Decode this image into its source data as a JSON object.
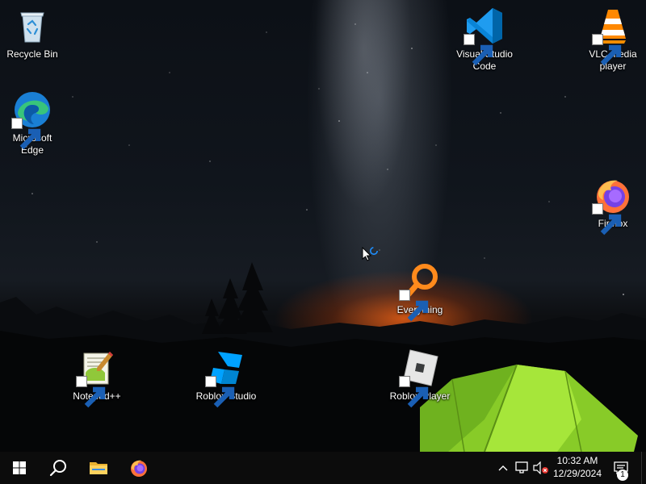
{
  "desktop": {
    "icons": [
      {
        "id": "recycle-bin",
        "label": "Recycle Bin"
      },
      {
        "id": "edge",
        "label": "Microsoft Edge"
      },
      {
        "id": "vscode",
        "label": "Visual Studio Code"
      },
      {
        "id": "vlc",
        "label": "VLC media player"
      },
      {
        "id": "firefox",
        "label": "Firefox"
      },
      {
        "id": "everything",
        "label": "Everything"
      },
      {
        "id": "notepadpp",
        "label": "Notepad++"
      },
      {
        "id": "roblox-studio",
        "label": "Roblox Studio"
      },
      {
        "id": "roblox-player",
        "label": "Roblox Player"
      }
    ]
  },
  "taskbar": {
    "pinned": [
      "windows-start-icon",
      "search-icon",
      "file-explorer-icon",
      "firefox-icon"
    ],
    "tray": [
      "chevron-up-icon",
      "network-icon",
      "volume-muted-icon"
    ],
    "clock": {
      "time": "10:32 AM",
      "date": "12/29/2024"
    },
    "notifications": {
      "count": "1"
    }
  },
  "colors": {
    "taskbar_bg": "#0c0c0c",
    "sunset_glow": "#eb5f14",
    "tent_green": "#8fd62a"
  }
}
